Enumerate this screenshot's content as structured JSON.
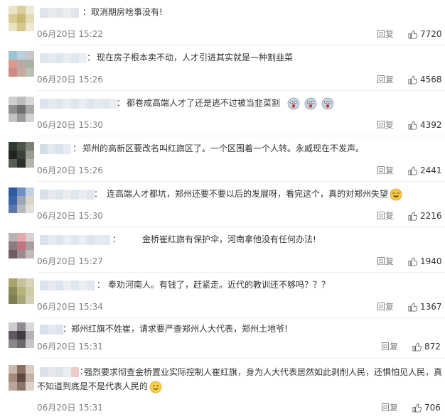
{
  "comments": [
    {
      "text": "取消期房啥事没有!",
      "time": "06月20日 15:22",
      "reply": "回复",
      "likes": "7720"
    },
    {
      "text": "现在房子根本卖不动，人才引进其实就是一种割韭菜",
      "time": "06月20日 15:26",
      "reply": "回复",
      "likes": "4568"
    },
    {
      "text": "都卷成高端人才了还是逃不过被当韭菜割",
      "time": "06月20日 15:30",
      "reply": "回复",
      "likes": "4392"
    },
    {
      "text": "郑州的高新区要改名叫红旗区了。一个区围着一个人转。永威现在不发声。",
      "time": "06月20日 15:26",
      "reply": "回复",
      "likes": "2441"
    },
    {
      "text": "连高端人才都坑，郑州还要不要以后的发展呀，看完这个，真的对郑州失望",
      "time": "06月20日 15:30",
      "reply": "回复",
      "likes": "2216"
    },
    {
      "text": "金桥崔红旗有保护伞，河南拿他没有任何办法!",
      "time": "06月20日 15:27",
      "reply": "回复",
      "likes": "1940"
    },
    {
      "text": "奉劝河南人。有钱了，赶紧走。近代的教训还不够吗？？？",
      "time": "06月20日 15:34",
      "reply": "回复",
      "likes": "1367"
    },
    {
      "text": "郑州红旗不姓崔，请求要严查郑州人大代表，郑州土地爷!",
      "time": "06月20日 15:31",
      "reply": "回复",
      "likes": "872"
    },
    {
      "text": "强烈要求彻查金桥置业实际控制人崔红旗，身为人大代表居然如此剥削人民，还惧怕见人民，真不知道到底是不是代表人民的",
      "time": "06月20日 15:31",
      "reply": "回复",
      "likes": "706"
    }
  ],
  "colors": {
    "text": "#333333",
    "meta": "#808080",
    "divider": "#eeeeee",
    "nickname_blur": "#d6dde6"
  },
  "icons": {
    "like": "thumbs-up-icon",
    "emoji_fear": "screaming-face-emoji",
    "emoji_sweat": "grinning-sweat-emoji",
    "emoji_smile": "smiling-face-emoji"
  }
}
